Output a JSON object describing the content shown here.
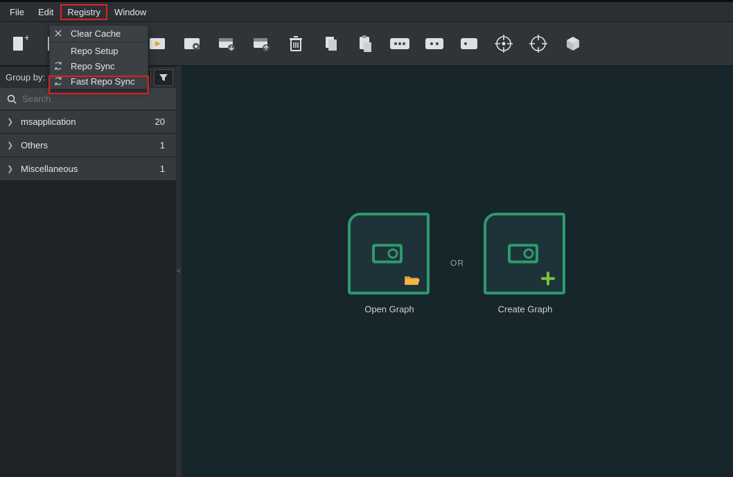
{
  "menubar": {
    "file": "File",
    "edit": "Edit",
    "registry": "Registry",
    "window": "Window"
  },
  "dropdown": {
    "clear_cache": "Clear Cache",
    "repo_setup": "Repo Setup",
    "repo_sync": "Repo Sync",
    "fast_repo_sync": "Fast Repo Sync"
  },
  "sidebar": {
    "groupby_label": "Group by:",
    "search_placeholder": "Search",
    "categories": [
      {
        "label": "msapplication",
        "count": "20"
      },
      {
        "label": "Others",
        "count": "1"
      },
      {
        "label": "Miscellaneous",
        "count": "1"
      }
    ]
  },
  "canvas": {
    "open_label": "Open Graph",
    "or_label": "OR",
    "create_label": "Create Graph"
  }
}
